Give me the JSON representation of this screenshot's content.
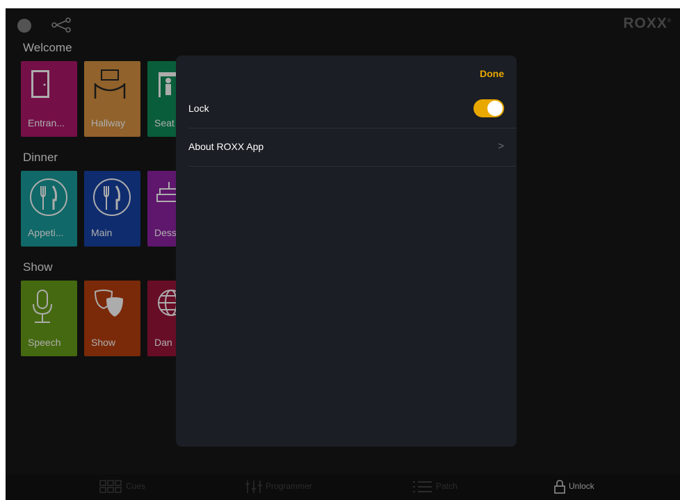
{
  "app": {
    "brand": "ROXX",
    "brand_mark": "®"
  },
  "sections": [
    {
      "title": "Welcome",
      "tiles": [
        {
          "label": "Entran...",
          "color": "#9c1561",
          "icon": "door-icon"
        },
        {
          "label": "Hallway",
          "color": "#c2833a",
          "icon": "stanchion-icon"
        },
        {
          "label": "Seat",
          "color": "#0d7c4e",
          "icon": "usher-icon"
        }
      ]
    },
    {
      "title": "Dinner",
      "tiles": [
        {
          "label": "Appeti...",
          "color": "#168b8b",
          "icon": "cutlery-icon"
        },
        {
          "label": "Main",
          "color": "#143b93",
          "icon": "cutlery-icon"
        },
        {
          "label": "Dess",
          "color": "#7e1f90",
          "icon": "cake-icon"
        }
      ]
    },
    {
      "title": "Show",
      "tiles": [
        {
          "label": "Speech",
          "color": "#5d8c16",
          "icon": "microphone-icon"
        },
        {
          "label": "Show",
          "color": "#a3380c",
          "icon": "theater-masks-icon"
        },
        {
          "label": "Dan",
          "color": "#8a1233",
          "icon": "globe-icon"
        }
      ]
    }
  ],
  "modal": {
    "done_label": "Done",
    "rows": [
      {
        "label": "Lock",
        "toggle_on": true
      },
      {
        "label": "About ROXX App",
        "chevron": ">"
      }
    ],
    "accent": "#e9a800"
  },
  "tabbar": [
    {
      "label": "Cues",
      "icon": "grid-icon"
    },
    {
      "label": "Programmer",
      "icon": "sliders-icon"
    },
    {
      "label": "Patch",
      "icon": "list-icon"
    },
    {
      "label": "Unlock",
      "icon": "lock-icon"
    }
  ]
}
